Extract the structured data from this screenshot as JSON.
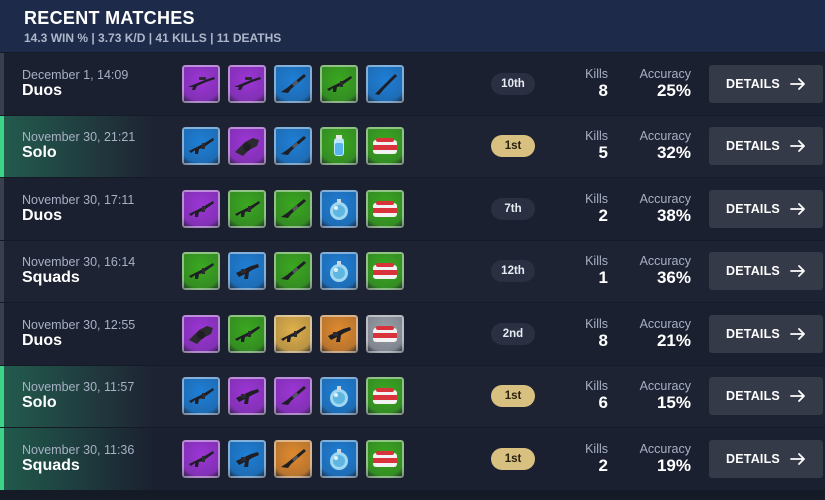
{
  "header": {
    "title": "RECENT MATCHES",
    "stats": "14.3 WIN % | 3.73 K/D | 41 KILLS | 11 DEATHS"
  },
  "labels": {
    "kills": "Kills",
    "accuracy": "Accuracy",
    "details": "DETAILS"
  },
  "rarity_colors": {
    "epic": "#9c35d6",
    "uncommon": "#3aa81f",
    "rare": "#1e7fd6",
    "legendary": "#e08a2e",
    "mythic": "#e0b04a",
    "common": "#9aa0a8"
  },
  "matches": [
    {
      "date": "December 1, 14:09",
      "mode": "Duos",
      "place": "10th",
      "top": false,
      "win": false,
      "kills": "8",
      "accuracy": "25%",
      "loadout": [
        {
          "rarity": "epic",
          "icon": "sniper-rifle-icon"
        },
        {
          "rarity": "epic",
          "icon": "sniper-rifle-icon"
        },
        {
          "rarity": "rare",
          "icon": "shotgun-icon"
        },
        {
          "rarity": "uncommon",
          "icon": "assault-rifle-icon"
        },
        {
          "rarity": "rare",
          "icon": "rifle-icon"
        }
      ]
    },
    {
      "date": "November 30, 21:21",
      "mode": "Solo",
      "place": "1st",
      "top": true,
      "win": true,
      "kills": "5",
      "accuracy": "32%",
      "loadout": [
        {
          "rarity": "rare",
          "icon": "assault-rifle-icon"
        },
        {
          "rarity": "epic",
          "icon": "minigun-icon"
        },
        {
          "rarity": "rare",
          "icon": "shotgun-icon"
        },
        {
          "rarity": "uncommon",
          "icon": "shield-potion-icon"
        },
        {
          "rarity": "uncommon",
          "icon": "medkit-icon"
        }
      ]
    },
    {
      "date": "November 30, 17:11",
      "mode": "Duos",
      "place": "7th",
      "top": false,
      "win": false,
      "kills": "2",
      "accuracy": "38%",
      "loadout": [
        {
          "rarity": "epic",
          "icon": "assault-rifle-icon"
        },
        {
          "rarity": "uncommon",
          "icon": "assault-rifle-icon"
        },
        {
          "rarity": "uncommon",
          "icon": "shotgun-icon"
        },
        {
          "rarity": "rare",
          "icon": "grenade-icon"
        },
        {
          "rarity": "uncommon",
          "icon": "medkit-icon"
        }
      ]
    },
    {
      "date": "November 30, 16:14",
      "mode": "Squads",
      "place": "12th",
      "top": false,
      "win": false,
      "kills": "1",
      "accuracy": "36%",
      "loadout": [
        {
          "rarity": "uncommon",
          "icon": "assault-rifle-icon"
        },
        {
          "rarity": "rare",
          "icon": "smg-icon"
        },
        {
          "rarity": "uncommon",
          "icon": "shotgun-icon"
        },
        {
          "rarity": "rare",
          "icon": "grenade-icon"
        },
        {
          "rarity": "uncommon",
          "icon": "medkit-icon"
        }
      ]
    },
    {
      "date": "November 30, 12:55",
      "mode": "Duos",
      "place": "2nd",
      "top": false,
      "win": false,
      "kills": "8",
      "accuracy": "21%",
      "loadout": [
        {
          "rarity": "epic",
          "icon": "minigun-icon"
        },
        {
          "rarity": "uncommon",
          "icon": "assault-rifle-icon"
        },
        {
          "rarity": "mythic",
          "icon": "assault-rifle-icon"
        },
        {
          "rarity": "legendary",
          "icon": "smg-icon"
        },
        {
          "rarity": "common",
          "icon": "medkit-icon"
        }
      ]
    },
    {
      "date": "November 30, 11:57",
      "mode": "Solo",
      "place": "1st",
      "top": true,
      "win": true,
      "kills": "6",
      "accuracy": "15%",
      "loadout": [
        {
          "rarity": "rare",
          "icon": "assault-rifle-icon"
        },
        {
          "rarity": "epic",
          "icon": "smg-icon"
        },
        {
          "rarity": "epic",
          "icon": "shotgun-icon"
        },
        {
          "rarity": "rare",
          "icon": "grenade-icon"
        },
        {
          "rarity": "uncommon",
          "icon": "medkit-icon"
        }
      ]
    },
    {
      "date": "November 30, 11:36",
      "mode": "Squads",
      "place": "1st",
      "top": true,
      "win": true,
      "kills": "2",
      "accuracy": "19%",
      "loadout": [
        {
          "rarity": "epic",
          "icon": "assault-rifle-icon"
        },
        {
          "rarity": "rare",
          "icon": "smg-icon"
        },
        {
          "rarity": "legendary",
          "icon": "shotgun-icon"
        },
        {
          "rarity": "rare",
          "icon": "grenade-icon"
        },
        {
          "rarity": "uncommon",
          "icon": "medkit-icon"
        }
      ]
    }
  ]
}
